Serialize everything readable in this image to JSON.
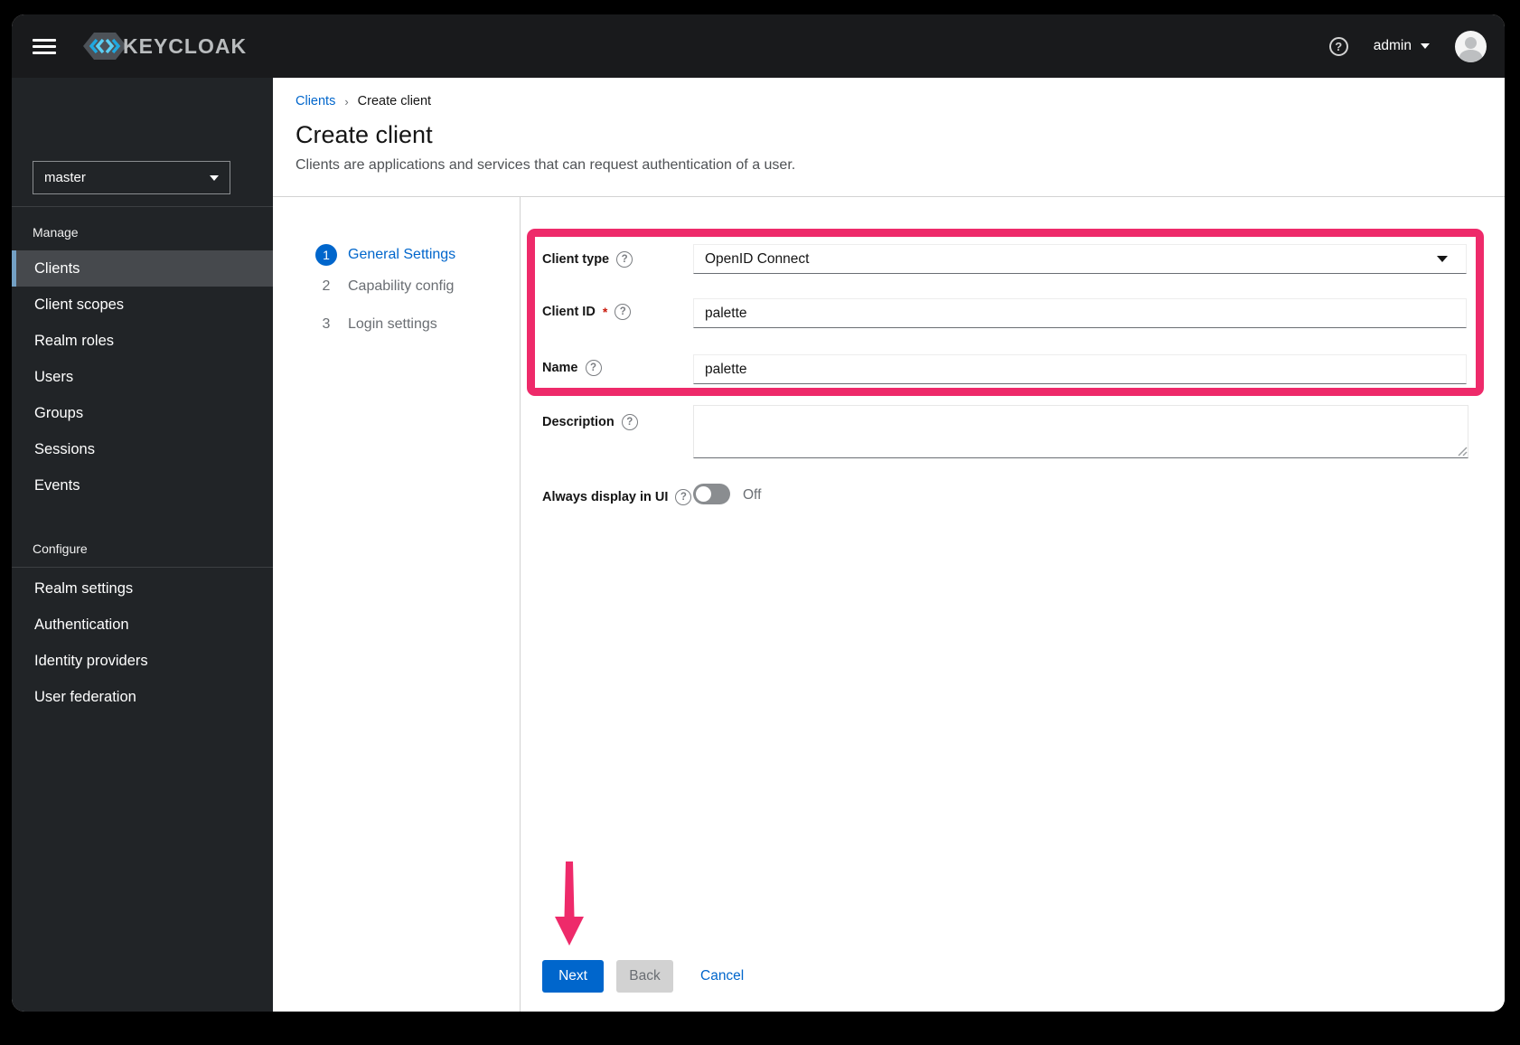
{
  "header": {
    "brand": "KEYCLOAK",
    "user_label": "admin",
    "help_glyph": "?"
  },
  "sidebar": {
    "realm_selector": {
      "value": "master"
    },
    "sections": [
      {
        "title": "Manage",
        "items": [
          {
            "label": "Clients",
            "current": true
          },
          {
            "label": "Client scopes"
          },
          {
            "label": "Realm roles"
          },
          {
            "label": "Users"
          },
          {
            "label": "Groups"
          },
          {
            "label": "Sessions"
          },
          {
            "label": "Events"
          }
        ]
      },
      {
        "title": "Configure",
        "items": [
          {
            "label": "Realm settings"
          },
          {
            "label": "Authentication"
          },
          {
            "label": "Identity providers"
          },
          {
            "label": "User federation"
          }
        ]
      }
    ]
  },
  "breadcrumb": {
    "items": [
      "Clients",
      "Create client"
    ],
    "separator": "›"
  },
  "page": {
    "title": "Create client",
    "subtitle": "Clients are applications and services that can request authentication of a user."
  },
  "wizard": {
    "steps": [
      {
        "num": "1",
        "label": "General Settings",
        "active": true
      },
      {
        "num": "2",
        "label": "Capability config",
        "active": false
      },
      {
        "num": "3",
        "label": "Login settings",
        "active": false
      }
    ]
  },
  "form": {
    "client_type": {
      "label": "Client type",
      "value": "OpenID Connect",
      "help_glyph": "?"
    },
    "client_id": {
      "label": "Client ID",
      "required_mark": "*",
      "value": "palette",
      "help_glyph": "?"
    },
    "name": {
      "label": "Name",
      "value": "palette",
      "help_glyph": "?"
    },
    "description": {
      "label": "Description",
      "value": "",
      "help_glyph": "?"
    },
    "always_display": {
      "label": "Always display in UI",
      "state": "Off",
      "help_glyph": "?"
    }
  },
  "actions": {
    "next": "Next",
    "back": "Back",
    "cancel": "Cancel"
  },
  "colors": {
    "annotation_pink": "#ee2a6a",
    "primary_blue": "#0066cc",
    "masthead": "#191a1c",
    "sidebar": "#212427"
  }
}
